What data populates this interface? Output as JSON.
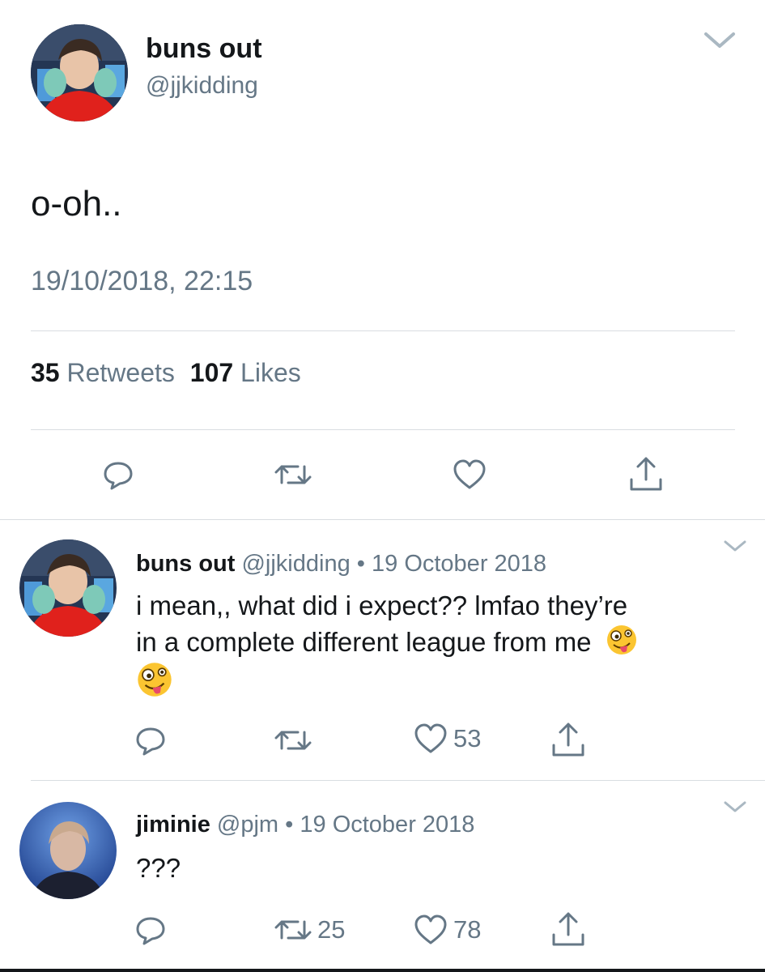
{
  "main_tweet": {
    "display_name": "buns out",
    "handle": "@jjkidding",
    "text": "o-oh..",
    "timestamp": "19/10/2018, 22:15",
    "stats": {
      "retweets_count": "35",
      "retweets_label": "Retweets",
      "likes_count": "107",
      "likes_label": "Likes"
    }
  },
  "replies": [
    {
      "display_name": "buns out",
      "handle": "@jjkidding",
      "dot": "•",
      "date": "19 October 2018",
      "text_line1": "i mean,, what did i expect?? lmfao they’re",
      "text_line2": "in a complete different league from me",
      "emoji": "🤪",
      "retweets": "",
      "likes": "53"
    },
    {
      "display_name": "jiminie",
      "handle": "@pjm",
      "dot": "•",
      "date": "19 October 2018",
      "text_line1": "???",
      "retweets": "25",
      "likes": "78"
    }
  ],
  "colors": {
    "text": "#14171a",
    "muted": "#657786",
    "divider": "#d9dde1",
    "avatar1_shirt": "#e0211c",
    "avatar3_bg": "#2a5fb0"
  },
  "icons": [
    "chevron-down-icon",
    "reply-icon",
    "retweet-icon",
    "like-icon",
    "share-icon"
  ]
}
